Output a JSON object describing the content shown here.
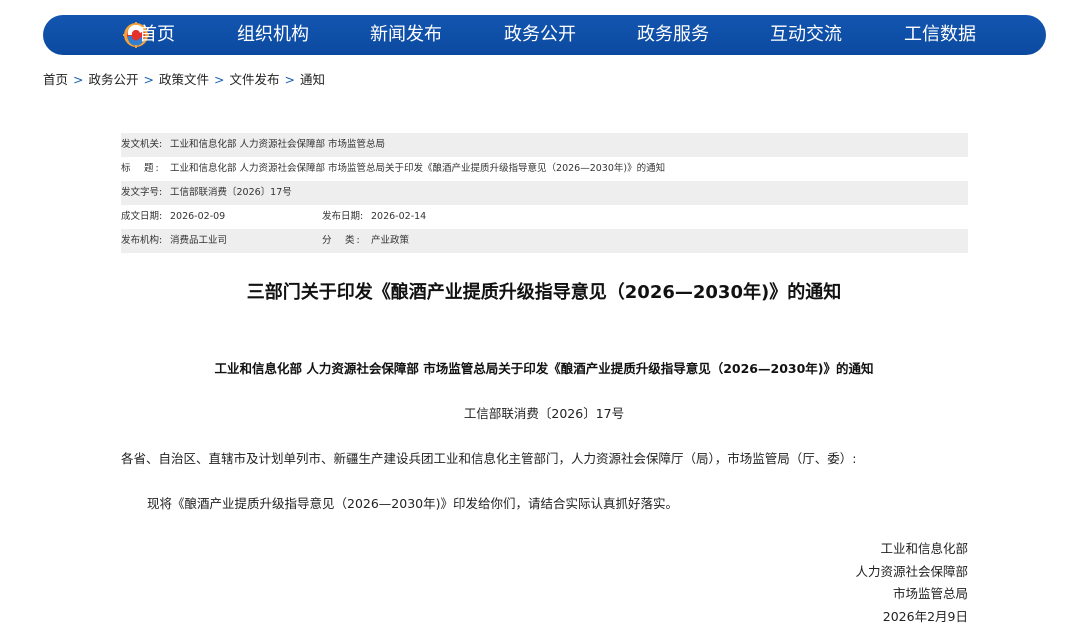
{
  "nav": {
    "logo_icon": "miit-logo-icon",
    "items": [
      {
        "label": "首页"
      },
      {
        "label": "组织机构"
      },
      {
        "label": "新闻发布"
      },
      {
        "label": "政务公开"
      },
      {
        "label": "政务服务"
      },
      {
        "label": "互动交流"
      },
      {
        "label": "工信数据"
      }
    ]
  },
  "breadcrumb": {
    "items": [
      "首页",
      "政务公开",
      "政策文件",
      "文件发布",
      "通知"
    ],
    "separator": ">"
  },
  "meta": {
    "issuer_label": "发文机关:",
    "issuer_value": "工业和信息化部 人力资源社会保障部 市场监管总局",
    "title_label": "标　题:",
    "title_value": "工业和信息化部 人力资源社会保障部 市场监管总局关于印发《酿酒产业提质升级指导意见（2026—2030年)》的通知",
    "doc_no_label": "发文字号:",
    "doc_no_value": "工信部联消费〔2026〕17号",
    "created_label": "成文日期:",
    "created_value": "2026-02-09",
    "published_label": "发布日期:",
    "published_value": "2026-02-14",
    "org_label": "发布机构:",
    "org_value": "消费品工业司",
    "category_label": "分　类:",
    "category_value": "产业政策"
  },
  "document": {
    "title": "三部门关于印发《酿酒产业提质升级指导意见（2026—2030年)》的通知",
    "subtitle": "工业和信息化部 人力资源社会保障部 市场监管总局关于印发《酿酒产业提质升级指导意见（2026—2030年)》的通知",
    "number": "工信部联消费〔2026〕17号",
    "salutation": "各省、自治区、直辖市及计划单列市、新疆生产建设兵团工业和信息化主管部门，人力资源社会保障厅（局），市场监管局（厅、委）:",
    "body": "现将《酿酒产业提质升级指导意见（2026—2030年)》印发给你们，请结合实际认真抓好落实。",
    "signature": {
      "org1": "工业和信息化部",
      "org2": "人力资源社会保障部",
      "org3": "市场监管总局",
      "date": "2026年2月9日"
    }
  },
  "colors": {
    "nav_background": "#0f50a8",
    "nav_text": "#ffffff",
    "breadcrumb_separator": "#1a5fb4",
    "meta_row_shade": "#eeeeee"
  }
}
